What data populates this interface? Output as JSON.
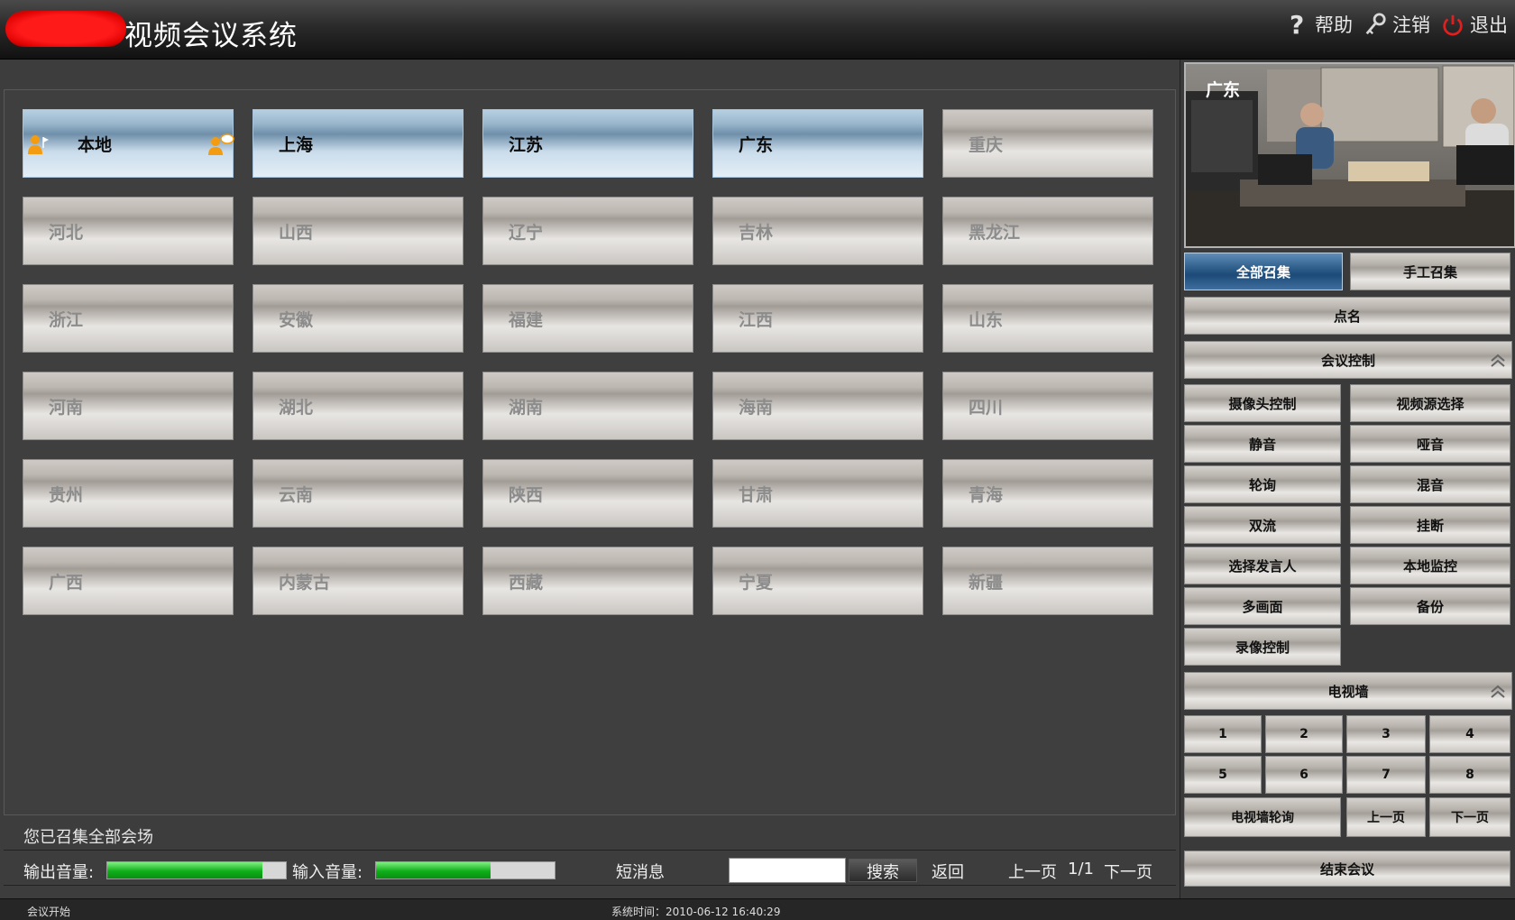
{
  "header": {
    "title": "视频会议系统",
    "help": "帮助",
    "logout": "注销",
    "exit": "退出"
  },
  "sites": [
    {
      "label": "本地",
      "active": true
    },
    {
      "label": "上海",
      "active": true
    },
    {
      "label": "江苏",
      "active": true
    },
    {
      "label": "广东",
      "active": true
    },
    {
      "label": "重庆",
      "active": false
    },
    {
      "label": "河北",
      "active": false
    },
    {
      "label": "山西",
      "active": false
    },
    {
      "label": "辽宁",
      "active": false
    },
    {
      "label": "吉林",
      "active": false
    },
    {
      "label": "黑龙江",
      "active": false
    },
    {
      "label": "浙江",
      "active": false
    },
    {
      "label": "安徽",
      "active": false
    },
    {
      "label": "福建",
      "active": false
    },
    {
      "label": "江西",
      "active": false
    },
    {
      "label": "山东",
      "active": false
    },
    {
      "label": "河南",
      "active": false
    },
    {
      "label": "湖北",
      "active": false
    },
    {
      "label": "湖南",
      "active": false
    },
    {
      "label": "海南",
      "active": false
    },
    {
      "label": "四川",
      "active": false
    },
    {
      "label": "贵州",
      "active": false
    },
    {
      "label": "云南",
      "active": false
    },
    {
      "label": "陕西",
      "active": false
    },
    {
      "label": "甘肃",
      "active": false
    },
    {
      "label": "青海",
      "active": false
    },
    {
      "label": "广西",
      "active": false
    },
    {
      "label": "内蒙古",
      "active": false
    },
    {
      "label": "西藏",
      "active": false
    },
    {
      "label": "宁夏",
      "active": false
    },
    {
      "label": "新疆",
      "active": false
    }
  ],
  "status_message": "您已召集全部会场",
  "bottom": {
    "output_volume_label": "输出音量:",
    "output_volume_level": 0.87,
    "input_volume_label": "输入音量:",
    "input_volume_level": 0.64,
    "sms": "短消息",
    "search_value": "",
    "search_button": "搜索",
    "back": "返回",
    "prev_page": "上一页",
    "page_indicator": "1/1",
    "next_page": "下一页"
  },
  "footer": {
    "left": "会议开始",
    "system_time": "系统时间：2010-06-12 16:40:29"
  },
  "video": {
    "site_label": "广东"
  },
  "controls": {
    "call_all": "全部召集",
    "manual_call": "手工召集",
    "roll_call": "点名",
    "meeting_control": "会议控制",
    "camera_control": "摄像头控制",
    "video_source": "视频源选择",
    "mute": "静音",
    "dumb": "哑音",
    "polling": "轮询",
    "audio_mix": "混音",
    "dual_stream": "双流",
    "hangup": "挂断",
    "select_speaker": "选择发言人",
    "local_monitor": "本地监控",
    "multi_screen": "多画面",
    "backup": "备份",
    "record_control": "录像控制",
    "tv_wall": "电视墙",
    "tv_wall_numbers": [
      "1",
      "2",
      "3",
      "4",
      "5",
      "6",
      "7",
      "8"
    ],
    "tv_wall_polling": "电视墙轮询",
    "tv_prev": "上一页",
    "tv_next": "下一页",
    "end_meeting": "结束会议"
  },
  "colors": {
    "active_site": "#9ab7cd",
    "inactive_site": "#bcb7b1",
    "primary_button": "#2f5f8c",
    "meter_fill": "#0fae1a",
    "person_icon": "#f39c12"
  }
}
